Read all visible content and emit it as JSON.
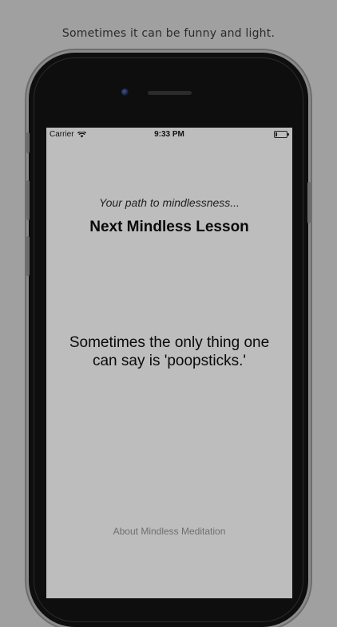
{
  "caption": "Sometimes it can be funny and light.",
  "status_bar": {
    "carrier": "Carrier",
    "time": "9:33 PM",
    "battery_level": 0.12,
    "icons": [
      "wifi-icon",
      "battery-icon"
    ]
  },
  "screen": {
    "tagline": "Your path to mindlessness...",
    "next_lesson_label": "Next Mindless Lesson",
    "lesson_text": "Sometimes the only thing one can say is 'poopsticks.'",
    "about_link": "About Mindless Meditation"
  },
  "colors": {
    "background": "#a0a0a0",
    "screen_background": "#bdbdbd",
    "phone_body": "#0e0e0e",
    "about_link": "#6f6f6f"
  }
}
